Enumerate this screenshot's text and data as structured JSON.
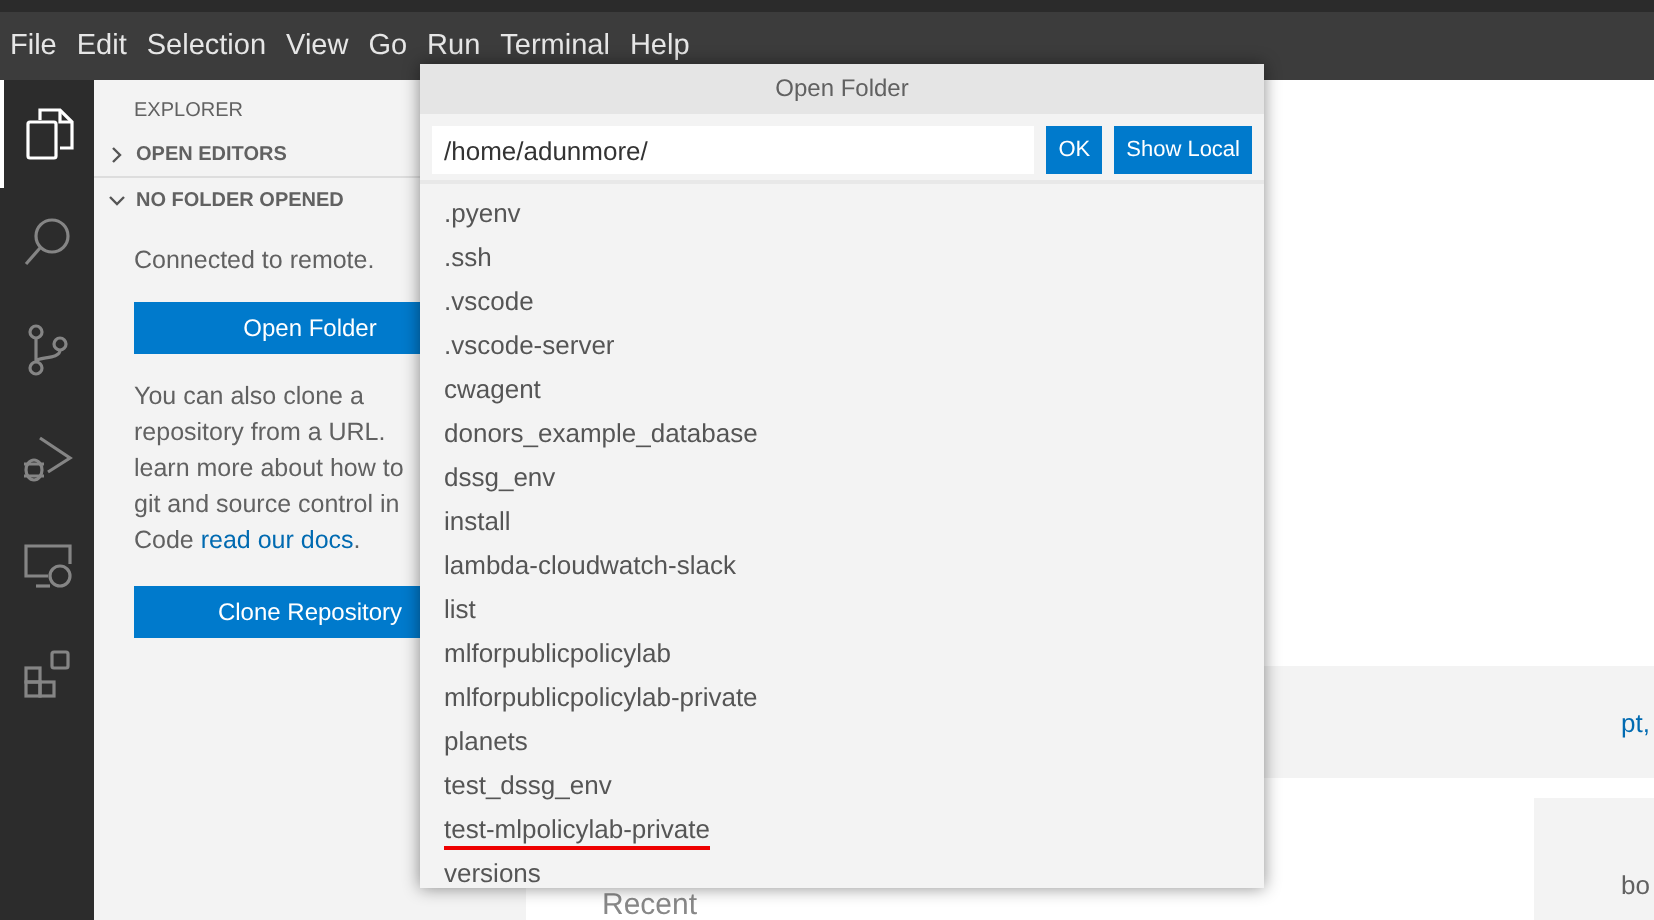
{
  "menu": [
    "File",
    "Edit",
    "Selection",
    "View",
    "Go",
    "Run",
    "Terminal",
    "Help"
  ],
  "activity_bar": [
    {
      "kind": "files",
      "selected": true
    },
    {
      "kind": "search",
      "selected": false
    },
    {
      "kind": "branch",
      "selected": false
    },
    {
      "kind": "debug",
      "selected": false
    },
    {
      "kind": "remote",
      "selected": false
    },
    {
      "kind": "extensions",
      "selected": false
    }
  ],
  "sidebar": {
    "title": "EXPLORER",
    "sections": [
      {
        "label": "OPEN EDITORS",
        "expanded": false
      },
      {
        "label": "NO FOLDER OPENED",
        "expanded": true
      }
    ],
    "message": "Connected to remote.",
    "open_button": "Open Folder",
    "clone_lines": [
      "You can also clone a",
      "repository from a URL.",
      "learn more about how to",
      "git and source control in"
    ],
    "clone_last": "Code ",
    "clone_link": "read our docs",
    "clone_end": ".",
    "clone_button": "Clone Repository"
  },
  "editor": {
    "fragments": [
      "pt,",
      "bo"
    ],
    "heading": "Recent"
  },
  "dialog": {
    "title": "Open Folder",
    "path": "/home/adunmore/",
    "buttons": [
      "OK",
      "Show Local"
    ],
    "items": [
      {
        "name": ".pyenv",
        "underlined": false
      },
      {
        "name": ".ssh",
        "underlined": false
      },
      {
        "name": ".vscode",
        "underlined": false
      },
      {
        "name": ".vscode-server",
        "underlined": false
      },
      {
        "name": "cwagent",
        "underlined": false
      },
      {
        "name": "donors_example_database",
        "underlined": false
      },
      {
        "name": "dssg_env",
        "underlined": false
      },
      {
        "name": "install",
        "underlined": false
      },
      {
        "name": "lambda-cloudwatch-slack",
        "underlined": false
      },
      {
        "name": "list",
        "underlined": false
      },
      {
        "name": "mlforpublicpolicylab",
        "underlined": false
      },
      {
        "name": "mlforpublicpolicylab-private",
        "underlined": false
      },
      {
        "name": "planets",
        "underlined": false
      },
      {
        "name": "test_dssg_env",
        "underlined": false
      },
      {
        "name": "test-mlpolicylab-private",
        "underlined": true
      },
      {
        "name": "versions",
        "underlined": false
      }
    ]
  }
}
